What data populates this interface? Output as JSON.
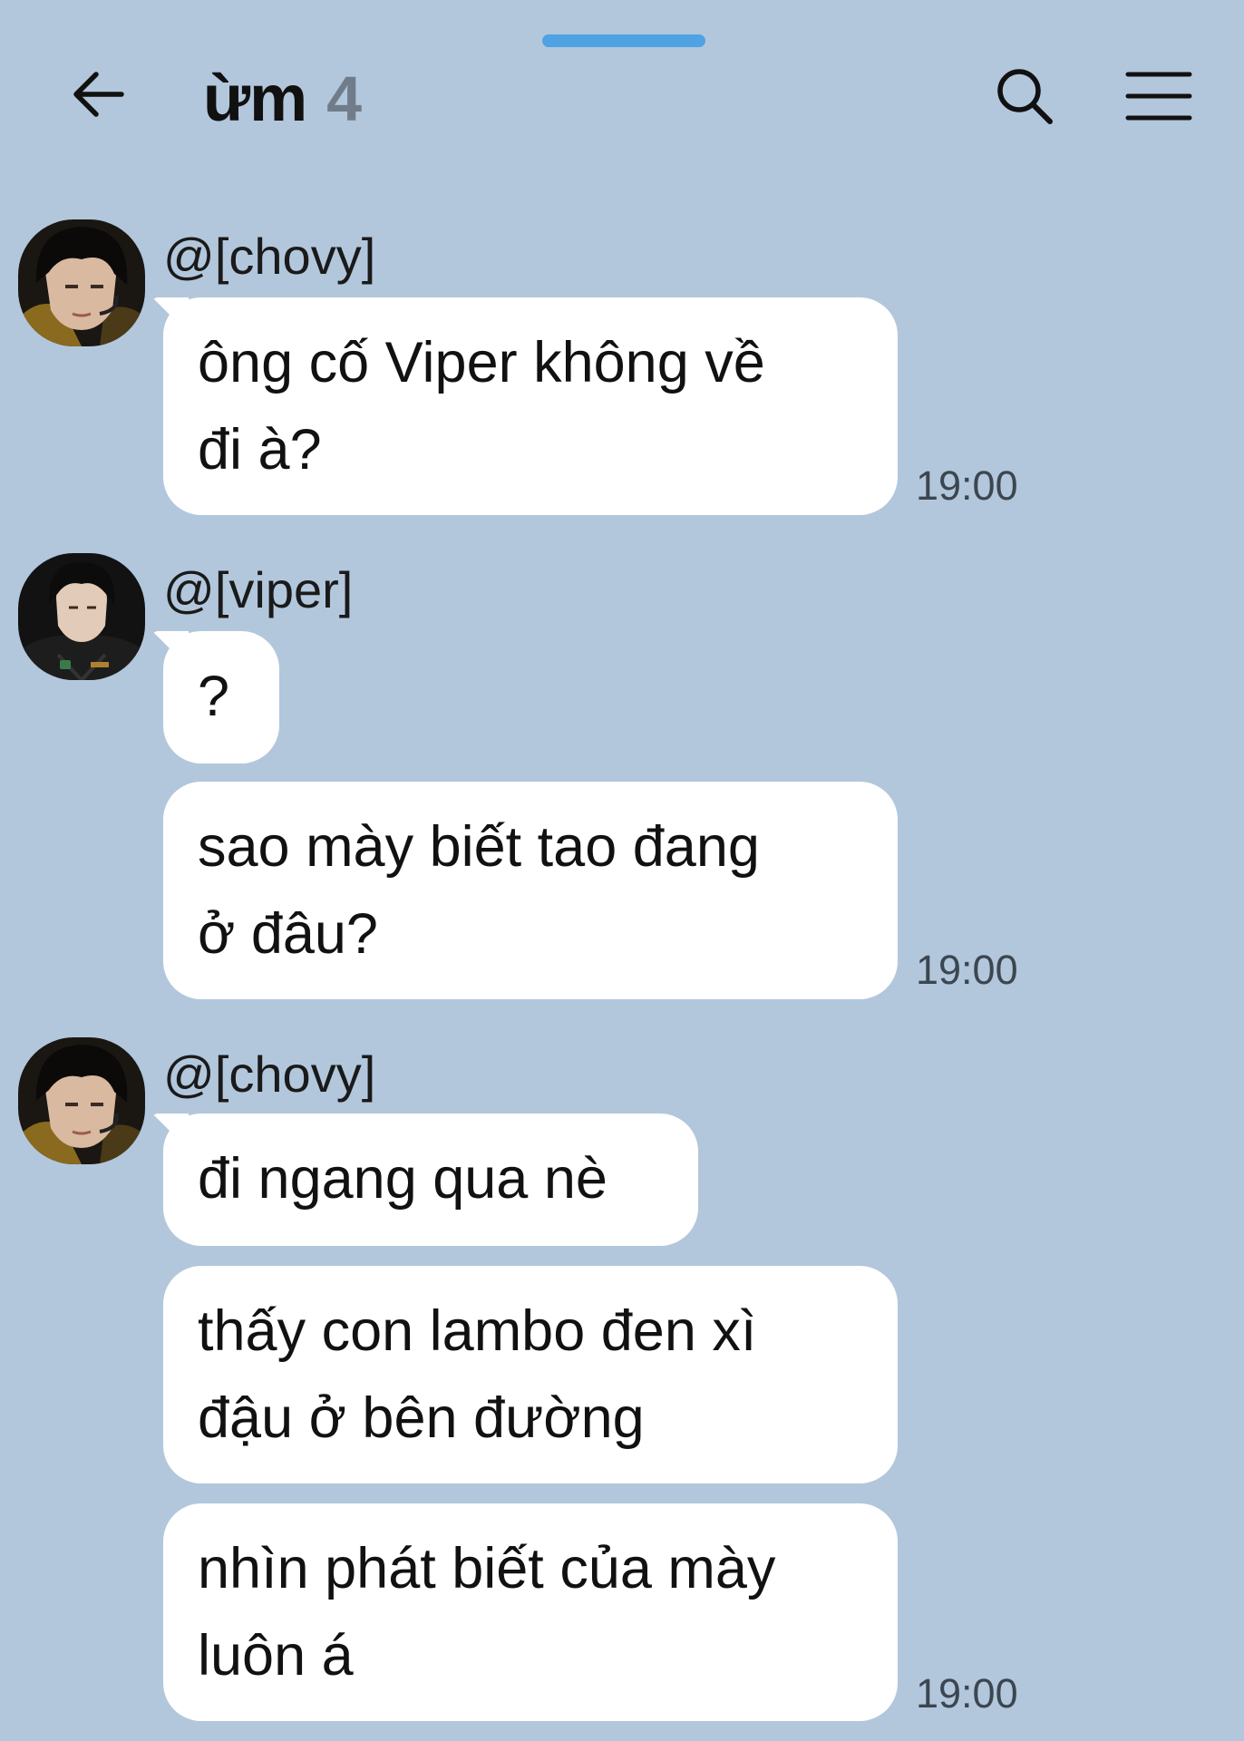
{
  "header": {
    "title": "ừm",
    "member_count": "4",
    "icons": {
      "back": "arrow-left-icon",
      "search": "search-icon",
      "menu": "hamburger-menu-icon"
    }
  },
  "messages": [
    {
      "sender": "@[chovy]",
      "bubbles": [
        "ông cố Viper không về\nđi à?"
      ],
      "time": "19:00"
    },
    {
      "sender": "@[viper]",
      "bubbles": [
        "?",
        "sao mày biết tao đang\nở đâu?"
      ],
      "time": "19:00"
    },
    {
      "sender": "@[chovy]",
      "bubbles": [
        "đi ngang qua nè",
        "thấy con lambo đen xì\nđậu ở bên đường",
        "nhìn phát biết của mày\nluôn á"
      ],
      "time": "19:00"
    }
  ],
  "colors": {
    "background": "#b2c7dc",
    "bubble": "#ffffff",
    "handle": "#4fa3e3",
    "member_count": "#707c89"
  }
}
